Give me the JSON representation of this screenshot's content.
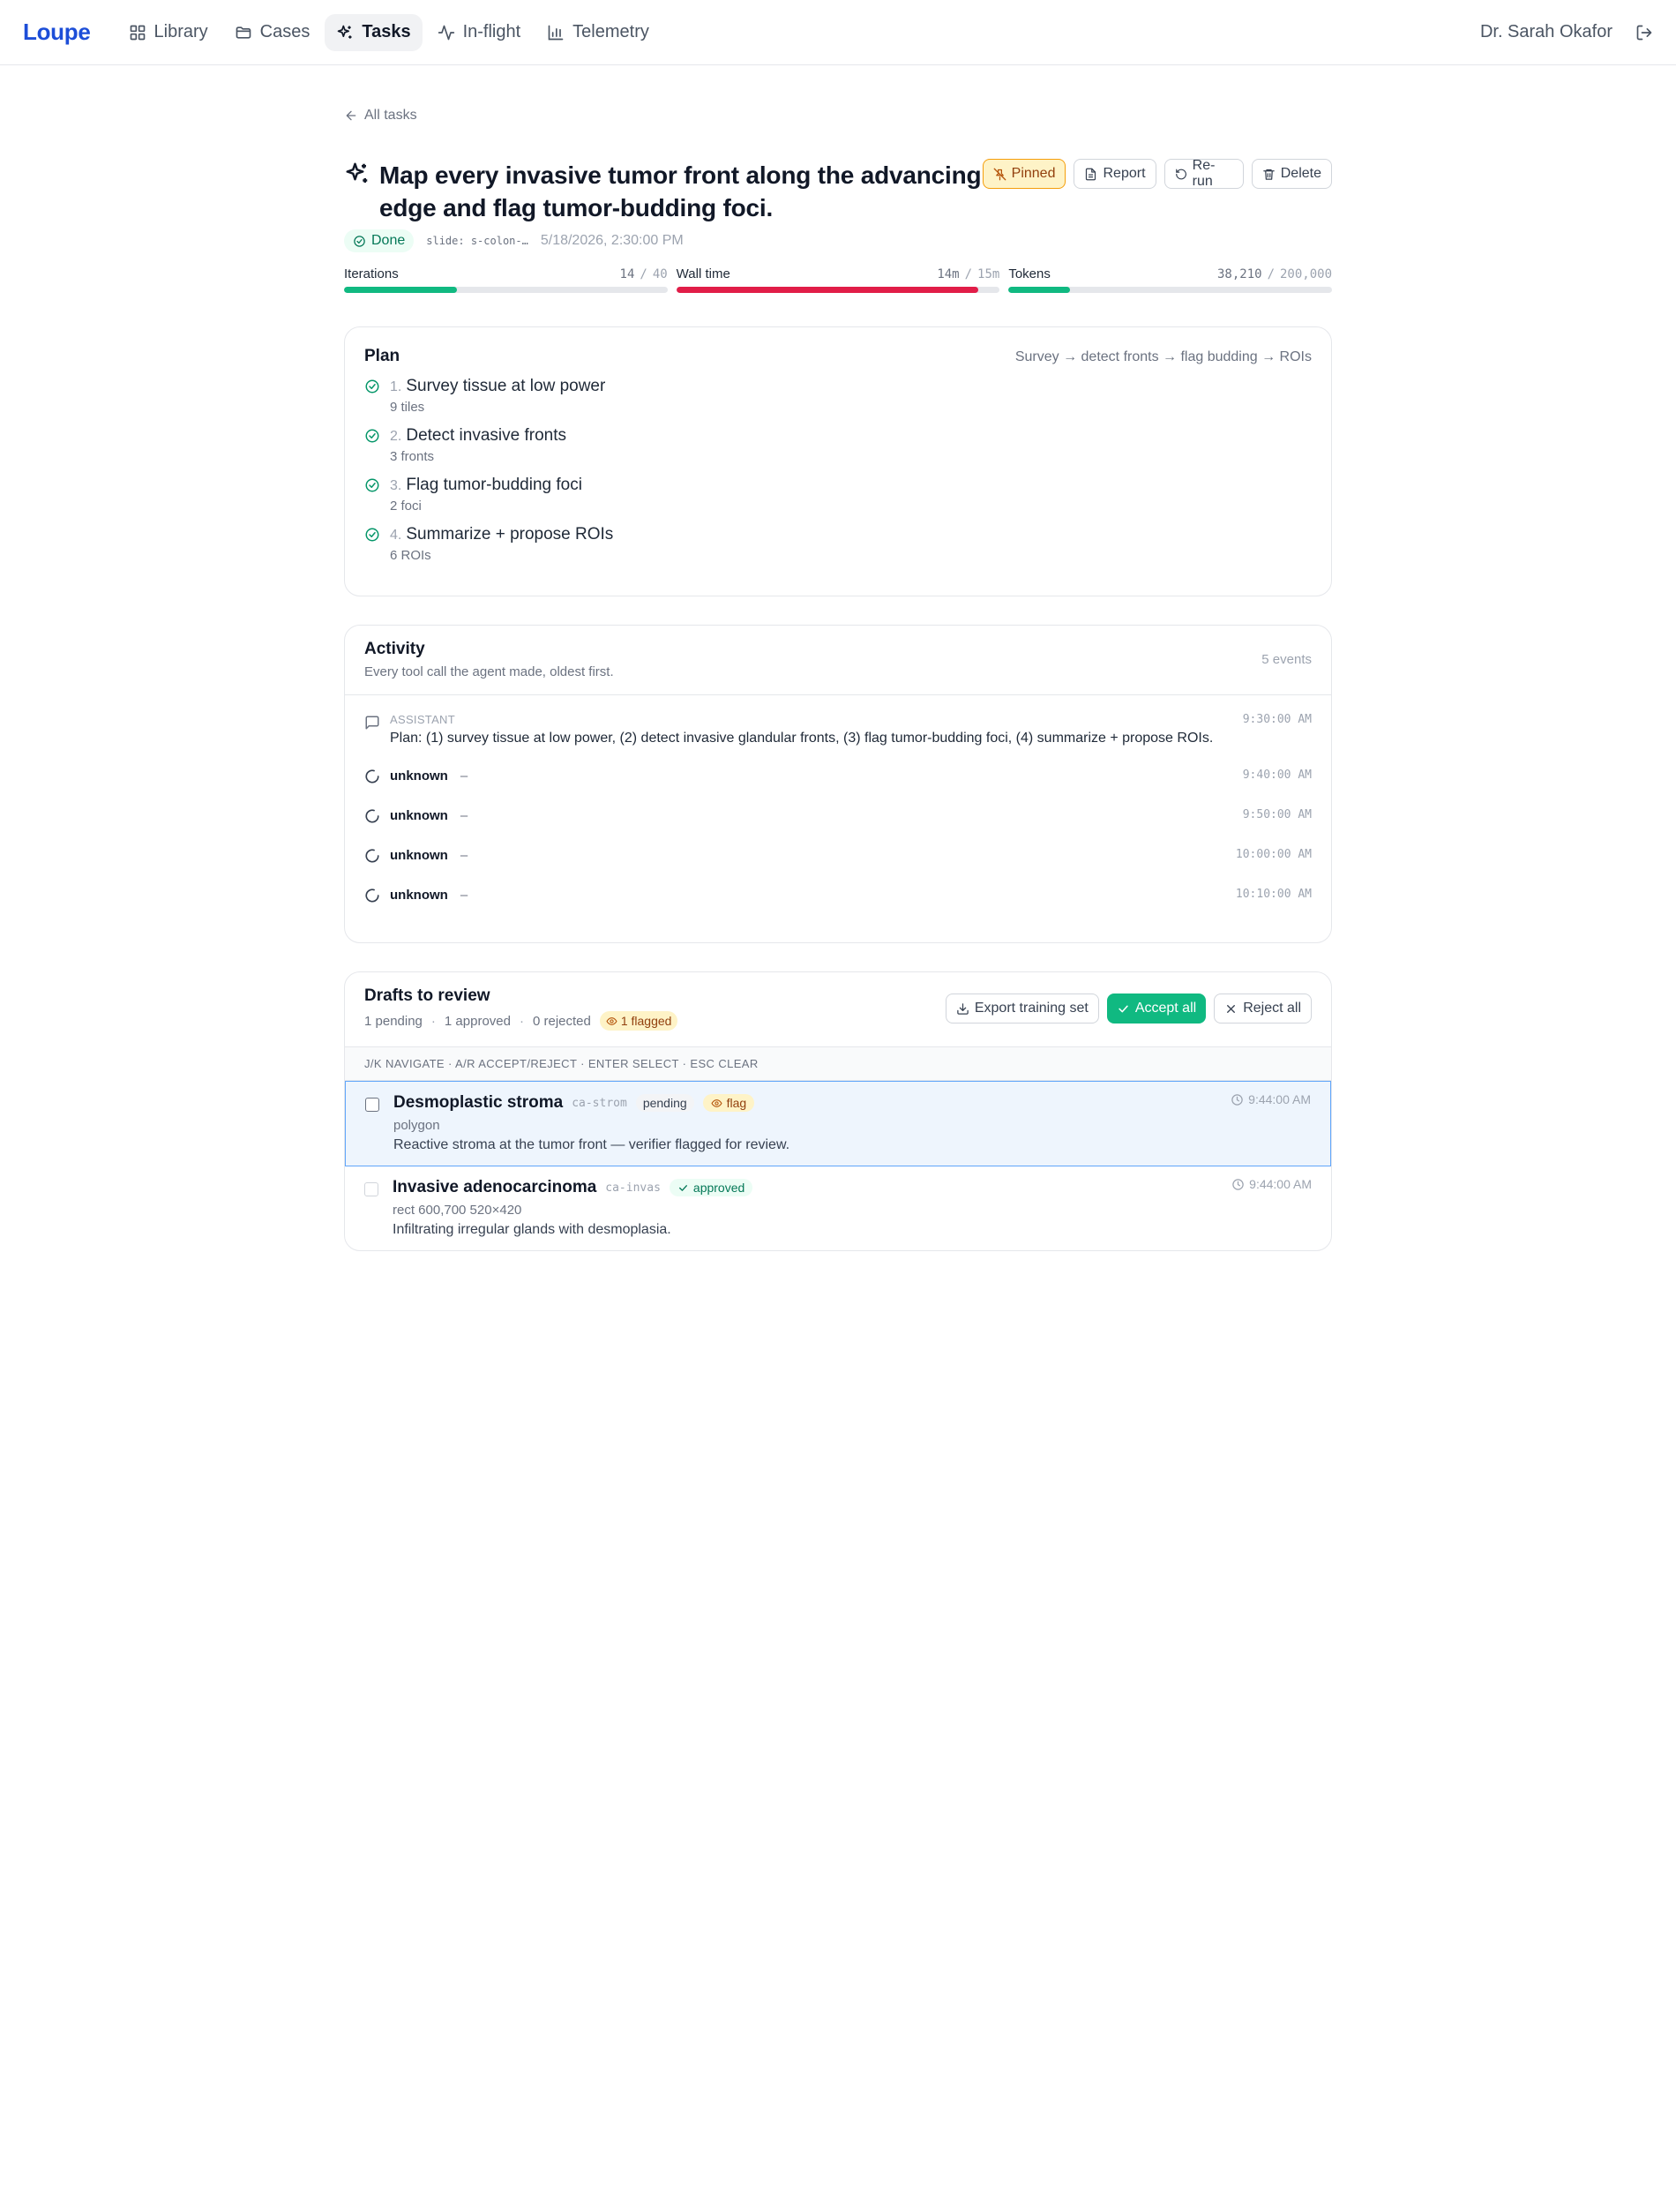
{
  "nav": {
    "logo": "Loupe",
    "items": [
      {
        "label": "Library",
        "icon": "grid-icon"
      },
      {
        "label": "Cases",
        "icon": "folder-icon"
      },
      {
        "label": "Tasks",
        "icon": "sparkles-icon",
        "active": true
      },
      {
        "label": "In-flight",
        "icon": "activity-icon"
      },
      {
        "label": "Telemetry",
        "icon": "bar-chart-icon"
      }
    ],
    "user": "Dr. Sarah Okafor"
  },
  "back_label": "All tasks",
  "task": {
    "title": "Map every invasive tumor front along the advancing edge and flag tumor-budding foci.",
    "status": "Done",
    "slide": "slide: s-colon-…",
    "created": "5/18/2026, 2:30:00 PM",
    "actions": {
      "pinned": "Pinned",
      "report": "Report",
      "rerun": "Re-run",
      "delete": "Delete"
    }
  },
  "metrics": [
    {
      "label": "Iterations",
      "value": "14",
      "max": "40",
      "fraction": 0.35,
      "color": "#10b981"
    },
    {
      "label": "Wall time",
      "value": "14m",
      "max": "15m",
      "fraction": 0.933,
      "color": "#e11d48"
    },
    {
      "label": "Tokens",
      "value": "38,210",
      "max": "200,000",
      "fraction": 0.191,
      "color": "#10b981"
    }
  ],
  "plan": {
    "title": "Plan",
    "summary": "Survey → detect fronts → flag budding → ROIs",
    "steps": [
      {
        "num": "1.",
        "name": "Survey tissue at low power",
        "result": "9 tiles"
      },
      {
        "num": "2.",
        "name": "Detect invasive fronts",
        "result": "3 fronts"
      },
      {
        "num": "3.",
        "name": "Flag tumor-budding foci",
        "result": "2 foci"
      },
      {
        "num": "4.",
        "name": "Summarize + propose ROIs",
        "result": "6 ROIs"
      }
    ]
  },
  "activity": {
    "title": "Activity",
    "subtitle": "Every tool call the agent made, oldest first.",
    "count": "5 events",
    "assistant": {
      "role": "ASSISTANT",
      "text": "Plan: (1) survey tissue at low power, (2) detect invasive glandular fronts, (3) flag tumor-budding foci, (4) summarize + propose ROIs.",
      "time": "9:30:00 AM"
    },
    "tools": [
      {
        "name": "unknown",
        "detail": "–",
        "time": "9:40:00 AM"
      },
      {
        "name": "unknown",
        "detail": "–",
        "time": "9:50:00 AM"
      },
      {
        "name": "unknown",
        "detail": "–",
        "time": "10:00:00 AM"
      },
      {
        "name": "unknown",
        "detail": "–",
        "time": "10:10:00 AM"
      }
    ]
  },
  "drafts": {
    "title": "Drafts to review",
    "pending": "1 pending",
    "approved": "1 approved",
    "rejected": "0 rejected",
    "flagged": "1 flagged",
    "export_label": "Export training set",
    "accept_label": "Accept all",
    "reject_label": "Reject all",
    "hint": "J/K NAVIGATE · A/R ACCEPT/REJECT · ENTER SELECT · ESC CLEAR",
    "items": [
      {
        "title": "Desmoplastic stroma",
        "code": "ca-strom",
        "status": "pending",
        "flag": "flag",
        "geom": "polygon",
        "desc": "Reactive stroma at the tumor front — verifier flagged for review.",
        "time": "9:44:00 AM"
      },
      {
        "title": "Invasive adenocarcinoma",
        "code": "ca-invas",
        "status": "approved",
        "geom": "rect 600,700 520×420",
        "desc": "Infiltrating irregular glands with desmoplasia.",
        "time": "9:44:00 AM"
      }
    ]
  }
}
